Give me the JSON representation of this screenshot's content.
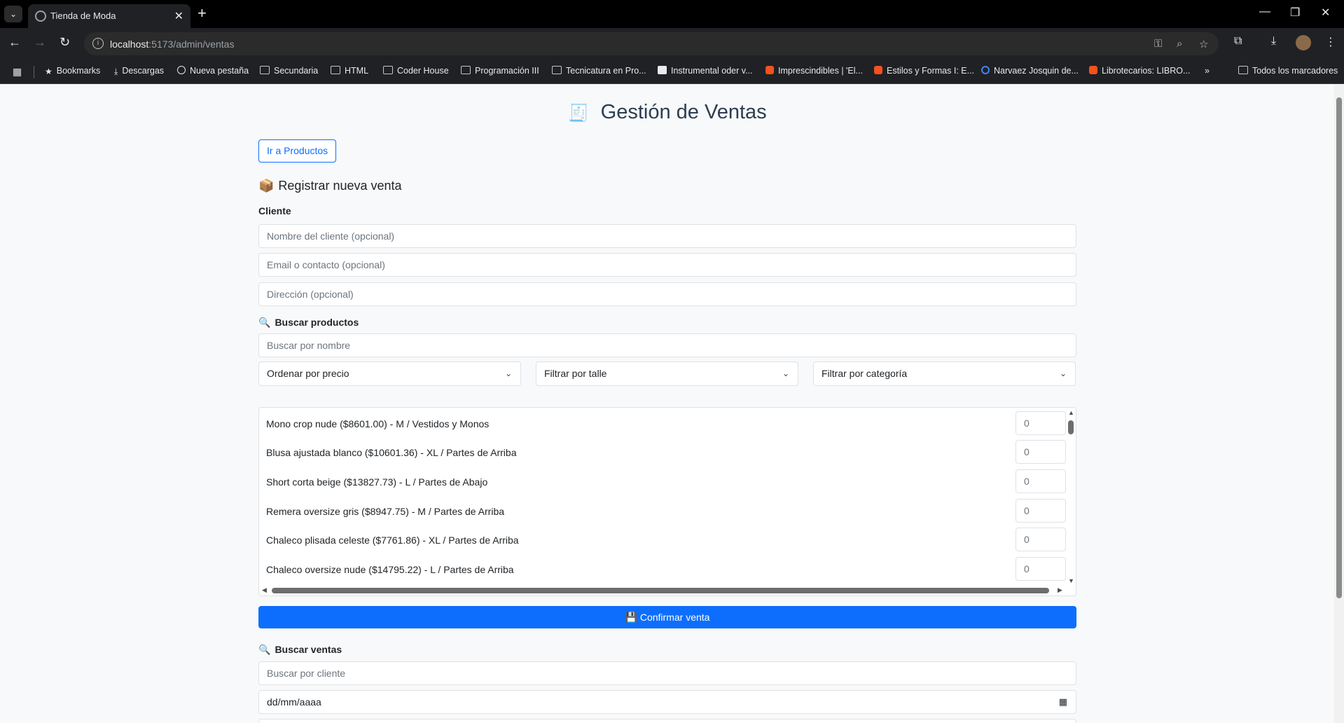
{
  "browser": {
    "tab_title": "Tienda de Moda",
    "url_host": "localhost",
    "url_path": ":5173/admin/ventas",
    "bookmarks": [
      {
        "label": "Bookmarks",
        "icon": "star-icon"
      },
      {
        "label": "Descargas",
        "icon": "download-icon"
      },
      {
        "label": "Nueva pestaña",
        "icon": "globe-icon"
      },
      {
        "label": "Secundaria",
        "icon": "folder-icon"
      },
      {
        "label": "HTML",
        "icon": "folder-icon"
      },
      {
        "label": "Coder House",
        "icon": "folder-icon"
      },
      {
        "label": "Programación III",
        "icon": "folder-icon"
      },
      {
        "label": "Tecnicatura en Pro...",
        "icon": "folder-icon"
      },
      {
        "label": "Instrumental oder v...",
        "icon": "site-icon"
      },
      {
        "label": "Imprescindibles | 'El...",
        "icon": "site-icon"
      },
      {
        "label": "Estilos y Formas I: E...",
        "icon": "blogger-icon"
      },
      {
        "label": "Narvaez Josquin de...",
        "icon": "google-icon"
      },
      {
        "label": "Librotecarios: LIBRO...",
        "icon": "blogger-icon"
      }
    ],
    "all_bookmarks": "Todos los marcadores"
  },
  "page": {
    "title": "Gestión de Ventas",
    "go_products": "Ir a Productos",
    "register_heading": "Registrar nueva venta",
    "client_label": "Cliente",
    "client_name_placeholder": "Nombre del cliente (opcional)",
    "client_email_placeholder": "Email o contacto (opcional)",
    "client_address_placeholder": "Dirección (opcional)",
    "search_products_heading": "Buscar productos",
    "search_products_placeholder": "Buscar por nombre",
    "sort_price": "Ordenar por precio",
    "filter_size": "Filtrar por talle",
    "filter_category": "Filtrar por categoría",
    "products": [
      {
        "text": "Mono crop nude ($8601.00) - M / Vestidos y Monos",
        "qty": "0"
      },
      {
        "text": "Blusa ajustada blanco ($10601.36) - XL / Partes de Arriba",
        "qty": "0"
      },
      {
        "text": "Short corta beige ($13827.73) - L / Partes de Abajo",
        "qty": "0"
      },
      {
        "text": "Remera oversize gris ($8947.75) - M / Partes de Arriba",
        "qty": "0"
      },
      {
        "text": "Chaleco plisada celeste ($7761.86) - XL / Partes de Arriba",
        "qty": "0"
      },
      {
        "text": "Chaleco oversize nude ($14795.22) - L / Partes de Arriba",
        "qty": "0"
      }
    ],
    "confirm_sale": "Confirmar venta",
    "search_sales_heading": "Buscar ventas",
    "search_sales_placeholder": "Buscar por cliente",
    "date_placeholder": "dd/mm/aaaa"
  },
  "colors": {
    "primary": "#0d6efd",
    "title": "#2c3e50",
    "browser_dark": "#202124"
  }
}
